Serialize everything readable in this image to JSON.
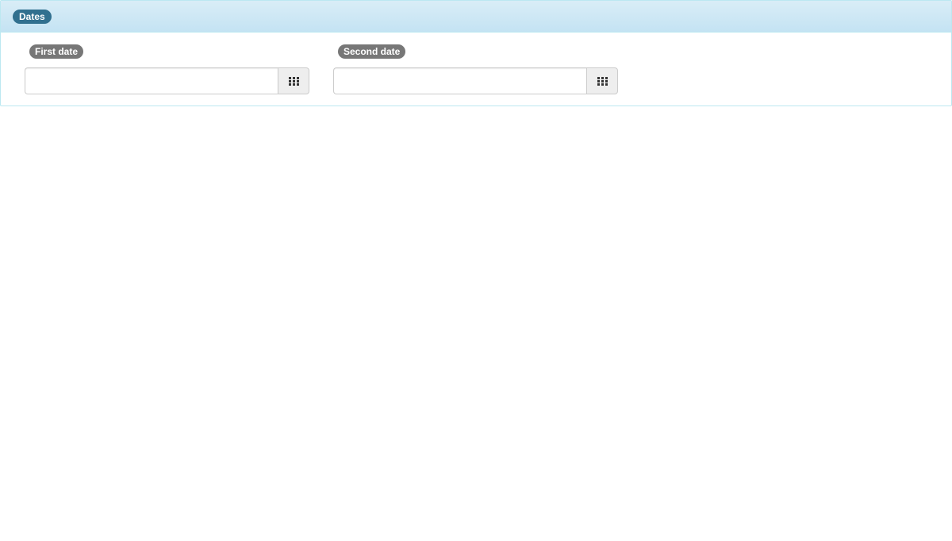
{
  "panel": {
    "title": "Dates"
  },
  "fields": [
    {
      "label": "First date",
      "value": "",
      "placeholder": "",
      "button_icon": "calendar-grid-icon"
    },
    {
      "label": "Second date",
      "value": "",
      "placeholder": "",
      "button_icon": "calendar-grid-icon"
    }
  ],
  "colors": {
    "panel_border": "#bce8f1",
    "panel_heading_bg": "#d9edf7",
    "panel_badge_bg": "#31708f",
    "field_label_bg": "#777777",
    "button_bg": "#eeeeee",
    "icon_color": "#333333"
  }
}
